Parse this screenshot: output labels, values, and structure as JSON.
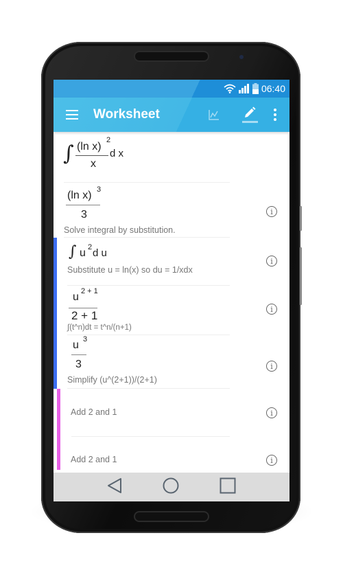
{
  "status_bar": {
    "time": "06:40",
    "icons": [
      "wifi-icon",
      "signal-icon",
      "battery-icon"
    ]
  },
  "app_bar": {
    "title": "Worksheet",
    "menu_icon": "hamburger-menu-icon",
    "actions": [
      "graph-icon",
      "pencil-edit-icon",
      "more-vert-icon"
    ]
  },
  "colors": {
    "accent": "#35b0e4",
    "status_bar": "#1e8ed8",
    "step_lane_blue": "#3d6ef5",
    "step_lane_magenta": "#e75fe6",
    "nav_bar": "#dcdcdc"
  },
  "worksheet": {
    "problem": {
      "integral_sign": "∫",
      "numerator": "(ln x)",
      "numerator_exp": "2",
      "denominator": "x",
      "differential": "d x"
    },
    "steps": [
      {
        "numerator": "(ln x)",
        "numerator_exp": "3",
        "denominator": "3",
        "description": "Solve integral by substitution."
      },
      {
        "integral_sign": "∫",
        "base": "u",
        "exp": "2",
        "differential": "d u",
        "description": "Substitute u = ln(x) so du = 1/xdx"
      },
      {
        "numerator": "u",
        "numerator_exp": "2 + 1",
        "denominator": "2 + 1",
        "description": "∫(t^n)dt = t^n/(n+1)"
      },
      {
        "numerator": "u",
        "numerator_exp": "3",
        "denominator": "3",
        "description": "Simplify (u^(2+1))/(2+1)"
      },
      {
        "description": "Add 2 and 1"
      },
      {
        "description": "Add 2 and 1"
      }
    ],
    "info_icon_glyph": "i"
  },
  "fab": {
    "icon": "pencil-icon"
  },
  "nav_bar": {
    "buttons": [
      "back-icon",
      "home-icon",
      "recents-icon"
    ]
  }
}
